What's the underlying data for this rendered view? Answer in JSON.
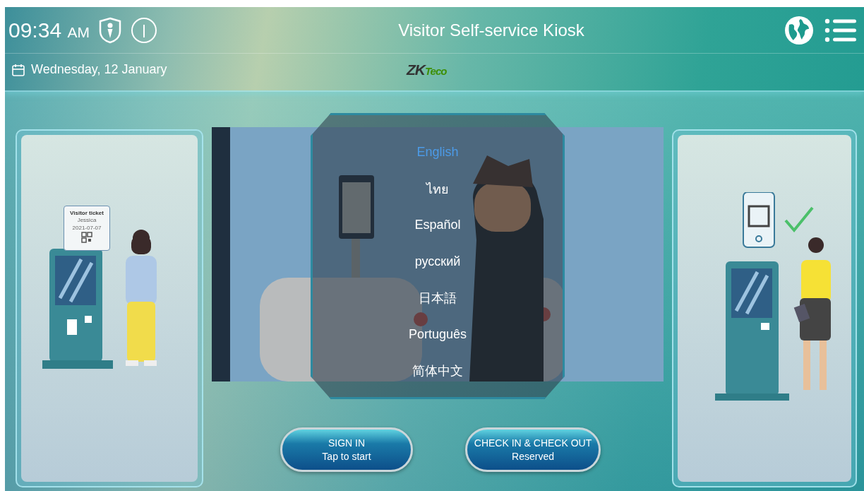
{
  "header": {
    "time": "09:34",
    "meridiem": "AM",
    "title": "Visitor Self-service Kiosk",
    "date": "Wednesday, 12 January",
    "logo": {
      "main": "ZK",
      "accent": "Teco"
    }
  },
  "left_card": {
    "ticket": {
      "title": "Visitor ticket",
      "name": "Jessica",
      "date": "2021-07-07"
    }
  },
  "language_menu": [
    {
      "label": "English",
      "selected": true
    },
    {
      "label": "ไทย",
      "selected": false
    },
    {
      "label": "Español",
      "selected": false
    },
    {
      "label": "русский",
      "selected": false
    },
    {
      "label": "日本語",
      "selected": false
    },
    {
      "label": "Português",
      "selected": false
    },
    {
      "label": "简体中文",
      "selected": false
    }
  ],
  "buttons": [
    {
      "title": "SIGN IN",
      "subtitle": "Tap to start"
    },
    {
      "title": "CHECK IN & CHECK OUT",
      "subtitle": "Reserved"
    }
  ]
}
